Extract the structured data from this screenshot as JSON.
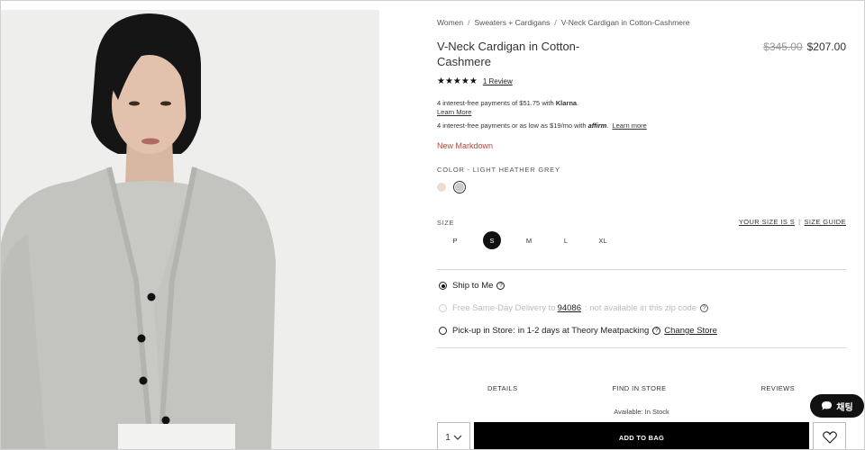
{
  "image": {
    "alt": "Model wearing light heather grey V-neck cardigan"
  },
  "breadcrumb": [
    "Women",
    "Sweaters + Cardigans",
    "V-Neck Cardigan in Cotton-Cashmere"
  ],
  "product": {
    "title": "V-Neck Cardigan in Cotton-Cashmere",
    "price_original": "$345.00",
    "price_sale": "$207.00"
  },
  "rating": {
    "stars": "★★★★★",
    "review_link": "1 Review"
  },
  "klarna": {
    "text_prefix": "4 interest-free payments of $51.75 with ",
    "brand": "Klarna",
    "text_suffix": ".",
    "learn": "Learn More"
  },
  "affirm": {
    "text": "4 interest-free payments or as low as $19/mo with ",
    "brand": "affirm",
    "punct": ".",
    "learn": "Learn more"
  },
  "markdown": "New Markdown",
  "color": {
    "label": "COLOR - LIGHT HEATHER GREY",
    "swatches": [
      {
        "name": "beige",
        "hex": "#ecdccb"
      },
      {
        "name": "light-heather-grey",
        "hex": "#c9cbc6"
      }
    ]
  },
  "size": {
    "label": "SIZE",
    "your_size": "YOUR SIZE IS S",
    "guide": "SIZE GUIDE",
    "options": [
      "P",
      "S",
      "M",
      "L",
      "XL"
    ],
    "selected": "S"
  },
  "shipping": {
    "ship_to_me": "Ship to Me",
    "same_day": "Free Same-Day Delivery to",
    "zip": "94086",
    "same_day_na": ": not available in this zip code",
    "pickup": "Pick-up in Store:",
    "pickup_detail": "in 1-2 days at Theory Meatpacking",
    "change_store": "Change Store"
  },
  "tabs": [
    "DETAILS",
    "FIND IN STORE",
    "REVIEWS"
  ],
  "availability": "Available: In Stock",
  "quantity": "1",
  "add_to_bag": "ADD TO BAG",
  "chat": "채팅",
  "colors": {
    "markdown": "#b0473d",
    "button": "#000000"
  }
}
